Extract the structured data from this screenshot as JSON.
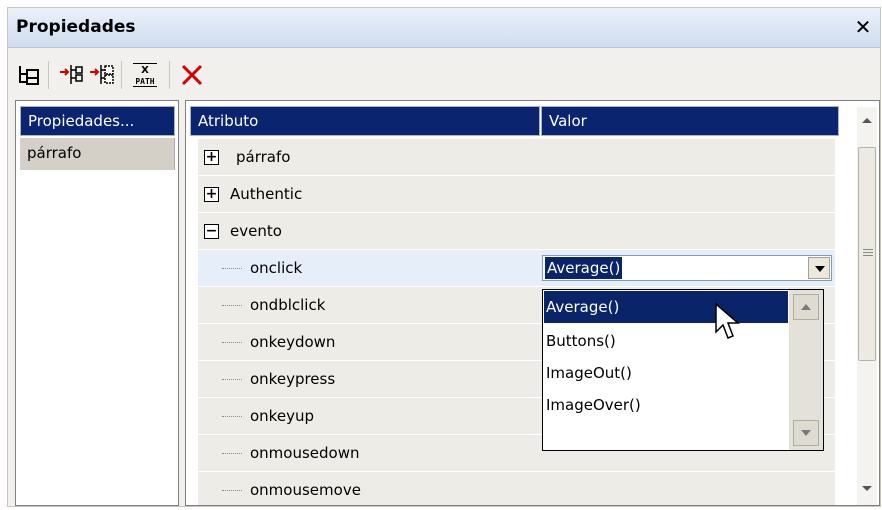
{
  "window": {
    "title": "Propiedades"
  },
  "toolbar": {
    "buttons": [
      {
        "icon": "tree-view-icon"
      },
      {
        "icon": "add-child-icon"
      },
      {
        "icon": "add-sibling-icon"
      },
      {
        "icon": "xpath-icon",
        "label_top": "X",
        "label_bottom": "PATH"
      },
      {
        "icon": "delete-icon"
      }
    ]
  },
  "left_panel": {
    "header": "Propiedades...",
    "items": [
      "párrafo"
    ]
  },
  "table": {
    "columns": [
      "Atributo",
      "Valor"
    ],
    "groups": [
      {
        "label": "párrafo",
        "expanded": false
      },
      {
        "label": "Authentic",
        "expanded": false
      },
      {
        "label": "evento",
        "expanded": true
      }
    ],
    "expander_collapsed": "+",
    "expander_expanded": "−",
    "events": [
      "onclick",
      "ondblclick",
      "onkeydown",
      "onkeypress",
      "onkeyup",
      "onmousedown",
      "onmousemove"
    ],
    "selected_event": "onclick",
    "selected_value": "Average()"
  },
  "dropdown": {
    "options": [
      "Average()",
      "Buttons()",
      "ImageOut()",
      "ImageOver()"
    ],
    "highlighted": "Average()"
  },
  "colors": {
    "header_bg": "#0a2470",
    "selection": "#0a246a",
    "title_gradient_top": "#eaf1fb",
    "title_gradient_bottom": "#cfdcef",
    "delete_red": "#d40000"
  }
}
